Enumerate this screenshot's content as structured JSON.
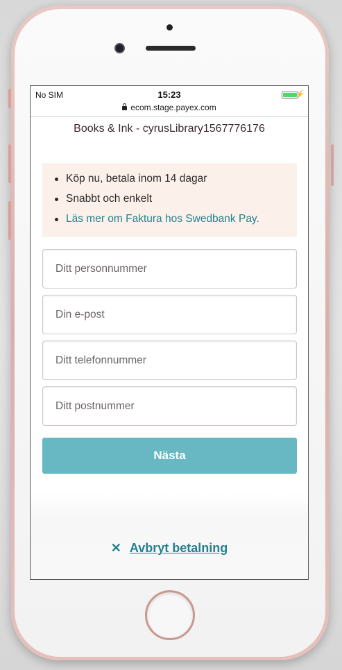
{
  "status_bar": {
    "carrier": "No SIM",
    "time": "15:23",
    "url": "ecom.stage.payex.com"
  },
  "merchant": "Books & Ink - cyrusLibrary1567776176",
  "info": {
    "items": [
      "Köp nu, betala inom 14 dagar",
      "Snabbt och enkelt"
    ],
    "link": "Läs mer om Faktura hos Swedbank Pay."
  },
  "form": {
    "ssn_placeholder": "Ditt personnummer",
    "email_placeholder": "Din e-post",
    "phone_placeholder": "Ditt telefonnummer",
    "zip_placeholder": "Ditt postnummer",
    "next_label": "Nästa"
  },
  "cancel": {
    "icon": "close-icon",
    "label": "Avbryt betalning"
  },
  "colors": {
    "accent": "#68b8c3",
    "link": "#24808f",
    "info_bg": "#fcf1ea"
  }
}
